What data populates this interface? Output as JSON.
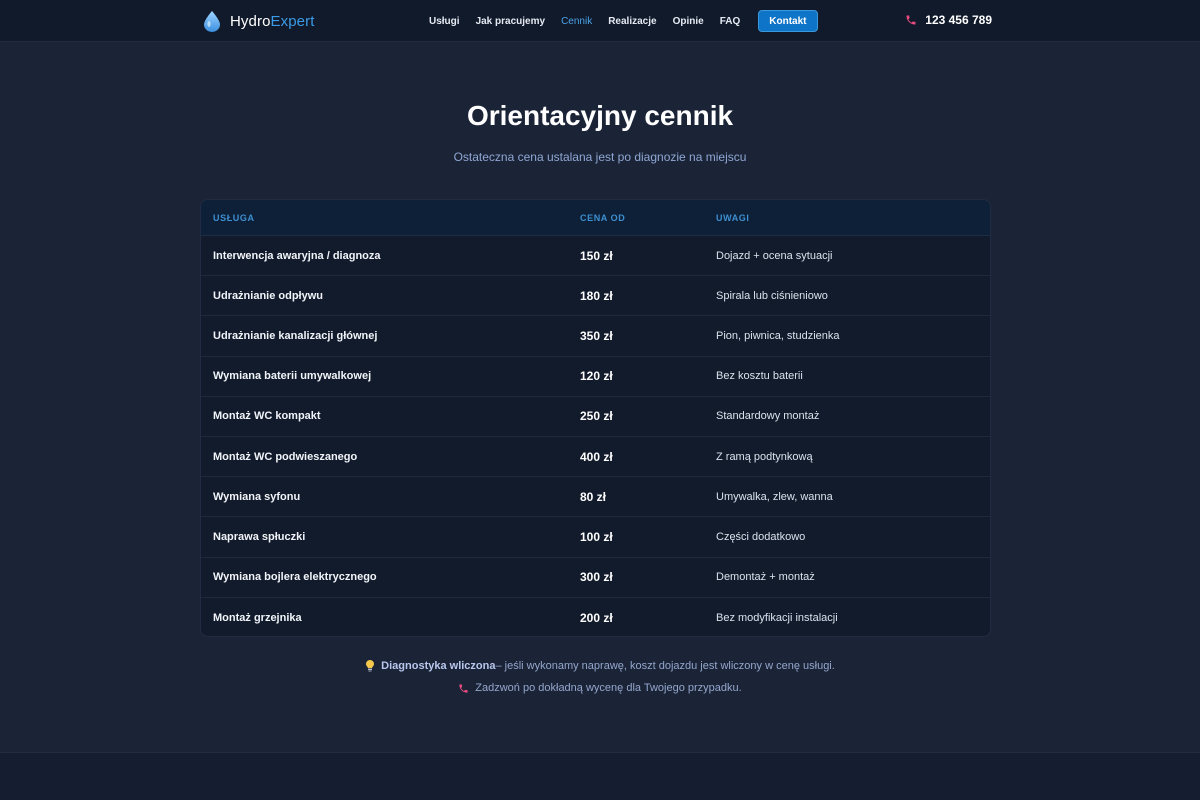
{
  "nav": {
    "logo_primary": "Hydro",
    "logo_accent": "Expert",
    "links": [
      "Usługi",
      "Jak pracujemy",
      "Cennik",
      "Realizacje",
      "Opinie",
      "FAQ"
    ],
    "active_link": "Cennik",
    "cta_label": "Kontakt",
    "phone": "123 456 789"
  },
  "page": {
    "title": "Orientacyjny cennik",
    "subtitle": "Ostateczna cena ustalana jest po diagnozie na miejscu"
  },
  "table": {
    "headers": [
      "USŁUGA",
      "CENA OD",
      "UWAGI"
    ],
    "rows": [
      {
        "service": "Interwencja awaryjna / diagnoza",
        "price": "150 zł",
        "note": "Dojazd + ocena sytuacji"
      },
      {
        "service": "Udrażnianie odpływu",
        "price": "180 zł",
        "note": "Spirala lub ciśnieniowo"
      },
      {
        "service": "Udrażnianie kanalizacji głównej",
        "price": "350 zł",
        "note": "Pion, piwnica, studzienka"
      },
      {
        "service": "Wymiana baterii umywalkowej",
        "price": "120 zł",
        "note": "Bez kosztu baterii"
      },
      {
        "service": "Montaż WC kompakt",
        "price": "250 zł",
        "note": "Standardowy montaż"
      },
      {
        "service": "Montaż WC podwieszanego",
        "price": "400 zł",
        "note": "Z ramą podtynkową"
      },
      {
        "service": "Wymiana syfonu",
        "price": "80 zł",
        "note": "Umywalka, zlew, wanna"
      },
      {
        "service": "Naprawa spłuczki",
        "price": "100 zł",
        "note": "Części dodatkowo"
      },
      {
        "service": "Wymiana bojlera elektrycznego",
        "price": "300 zł",
        "note": "Demontaż + montaż"
      },
      {
        "service": "Montaż grzejnika",
        "price": "200 zł",
        "note": "Bez modyfikacji instalacji"
      }
    ]
  },
  "notes": {
    "note1_bold": "Diagnostyka wliczona",
    "note1_rest": " – jeśli wykonamy naprawę, koszt dojazdu jest wliczony w cenę usługi.",
    "note2": "Zadzwoń po dokładną wycenę dla Twojego przypadku."
  },
  "icons": {
    "logo": "water-drop-icon",
    "phone": "phone-icon",
    "note1": "lightbulb-icon",
    "note2": "phone-icon"
  },
  "colors": {
    "accent": "#3b9be6",
    "cta": "#0e74c7",
    "phone_icon": "#e84a7f"
  }
}
